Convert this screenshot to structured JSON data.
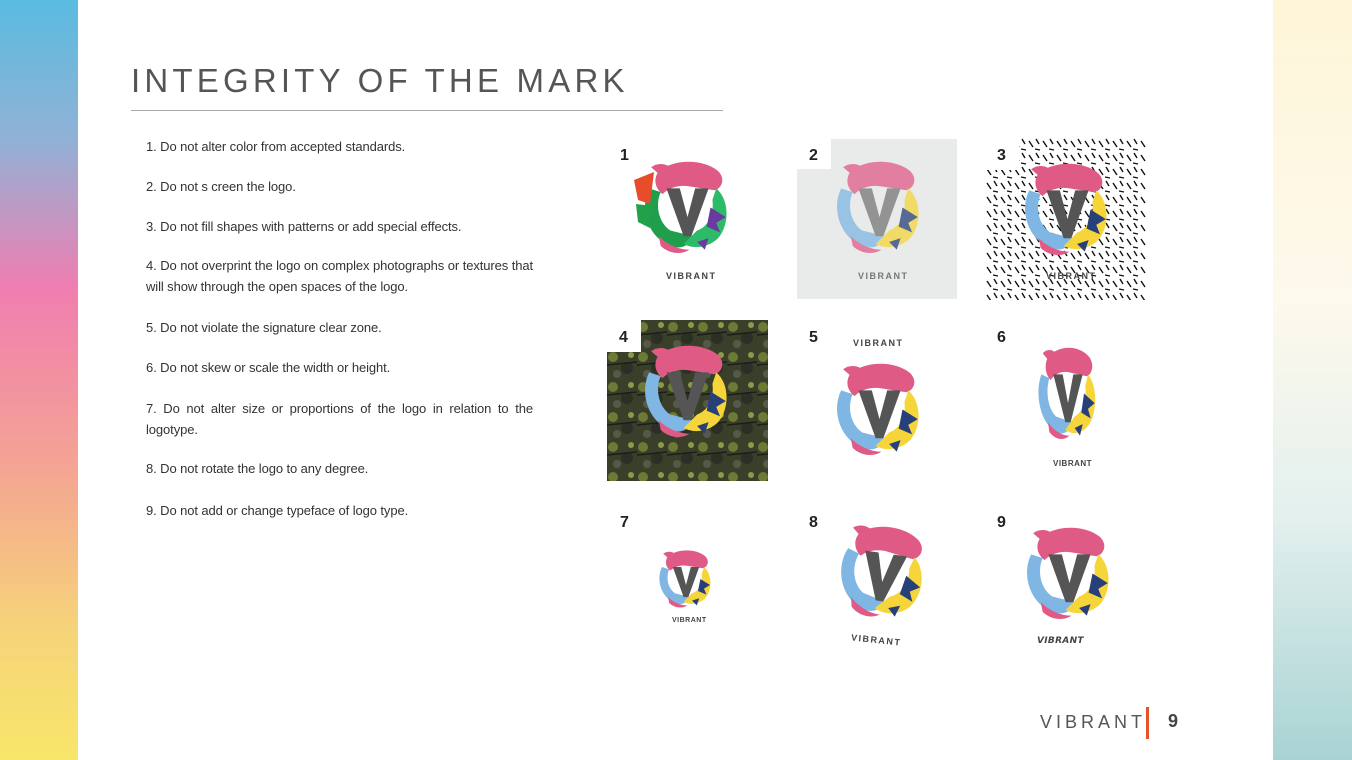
{
  "page": {
    "title": "INTEGRITY OF THE MARK",
    "footer_brand": "VIBRANT",
    "page_number": "9"
  },
  "rules": [
    "1. Do not alter color from accepted standards.",
    "2. Do not s creen the logo.",
    "3. Do not fill shapes with patterns or add special effects.",
    "4. Do not overprint the logo on complex photographs or textures that will show through the open spaces of the logo.",
    "5. Do not violate the signature clear zone.",
    "6. Do not skew or scale the width or height.",
    "7. Do not alter size or proportions of the logo in relation to the logotype.",
    "8. Do not rotate the logo to any degree.",
    "9. Do not add or change typeface of logo type."
  ],
  "examples": [
    {
      "number": "1",
      "wordmark": "VIBRANT"
    },
    {
      "number": "2",
      "wordmark": "VIBRANT"
    },
    {
      "number": "3",
      "wordmark": "VIBRANT"
    },
    {
      "number": "4",
      "wordmark": ""
    },
    {
      "number": "5",
      "wordmark": "VIBRANT"
    },
    {
      "number": "6",
      "wordmark": "VIBRANT"
    },
    {
      "number": "7",
      "wordmark": "VIBRANT"
    },
    {
      "number": "8",
      "wordmark": "VIBRANT"
    },
    {
      "number": "9",
      "wordmark": "VIBRANT"
    }
  ],
  "colors": {
    "accent": "#e4542b",
    "logo_pink": "#e05a86",
    "logo_yellow": "#f6d53b",
    "logo_blue": "#7fb6e3",
    "logo_navy": "#27407a",
    "logo_v": "#555555"
  }
}
